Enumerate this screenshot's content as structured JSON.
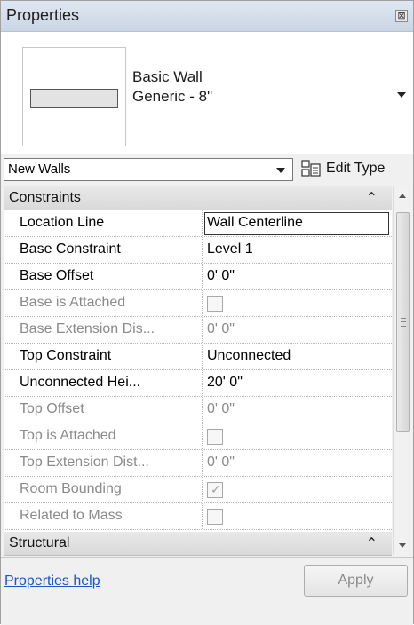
{
  "panel": {
    "title": "Properties",
    "close_glyph": "⊠"
  },
  "type_selector": {
    "family": "Basic Wall",
    "type": "Generic - 8\""
  },
  "instance_filter": {
    "value": "New Walls",
    "edit_type_label": "Edit Type"
  },
  "groups": {
    "constraints": "Constraints",
    "structural": "Structural",
    "collapse_glyph": "≈"
  },
  "rows": [
    {
      "name": "Location Line",
      "value": "Wall Centerline",
      "state": "active",
      "kind": "text-edit"
    },
    {
      "name": "Base Constraint",
      "value": "Level 1",
      "state": "active",
      "kind": "text"
    },
    {
      "name": "Base Offset",
      "value": "0'  0\"",
      "state": "active",
      "kind": "text"
    },
    {
      "name": "Base is Attached",
      "value": "",
      "state": "inactive",
      "kind": "checkbox",
      "checked": false
    },
    {
      "name": "Base Extension Dis...",
      "value": "0'  0\"",
      "state": "inactive",
      "kind": "text"
    },
    {
      "name": "Top Constraint",
      "value": "Unconnected",
      "state": "active",
      "kind": "text"
    },
    {
      "name": "Unconnected Hei...",
      "value": "20'  0\"",
      "state": "active",
      "kind": "text"
    },
    {
      "name": "Top Offset",
      "value": "0'  0\"",
      "state": "inactive",
      "kind": "text"
    },
    {
      "name": "Top is Attached",
      "value": "",
      "state": "inactive",
      "kind": "checkbox",
      "checked": false
    },
    {
      "name": "Top Extension Dist...",
      "value": "0'  0\"",
      "state": "inactive",
      "kind": "text"
    },
    {
      "name": "Room Bounding",
      "value": "",
      "state": "inactive",
      "kind": "checkbox",
      "checked": true
    },
    {
      "name": "Related to Mass",
      "value": "",
      "state": "inactive",
      "kind": "checkbox",
      "checked": false
    }
  ],
  "footer": {
    "help_link": "Properties help",
    "apply_label": "Apply"
  },
  "colors": {
    "link": "#1a56c8",
    "inactive_text": "#8a8a8a",
    "title_bar": "#d3dce8"
  }
}
